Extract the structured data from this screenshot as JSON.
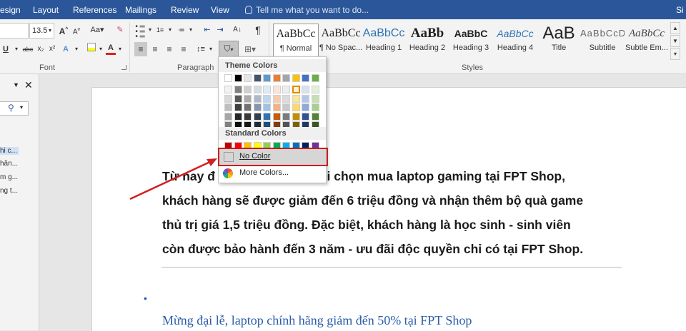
{
  "menubar": {
    "tabs": [
      "esign",
      "Layout",
      "References",
      "Mailings",
      "Review",
      "View"
    ],
    "tell_me": "Tell me what you want to do...",
    "right_cut": "Si"
  },
  "ribbon": {
    "font_size": "13.5",
    "group_labels": {
      "font": "Font",
      "paragraph": "Paragraph",
      "styles": "Styles"
    },
    "styles": [
      {
        "sample": "AaBbCc",
        "name": "¶ Normal"
      },
      {
        "sample": "AaBbCc",
        "name": "¶ No Spac..."
      },
      {
        "sample": "AaBbCc",
        "name": "Heading 1"
      },
      {
        "sample": "AaBb",
        "name": "Heading 2"
      },
      {
        "sample": "AaBbC",
        "name": "Heading 3"
      },
      {
        "sample": "AaBbCc",
        "name": "Heading 4"
      },
      {
        "sample": "AaB",
        "name": "Title"
      },
      {
        "sample": "AaBbCcD",
        "name": "Subtitle"
      },
      {
        "sample": "AaBbCc",
        "name": "Subtle Em..."
      }
    ]
  },
  "nav_pane": {
    "items": [
      "hi c...",
      "hăn...",
      "m g...",
      "ng t..."
    ]
  },
  "palette": {
    "theme_header": "Theme Colors",
    "standard_header": "Standard Colors",
    "no_color": "No Color",
    "more_colors": "More Colors...",
    "theme_top": [
      "#ffffff",
      "#000000",
      "#e7e6e6",
      "#44546a",
      "#5b9bd5",
      "#ed7d31",
      "#a5a5a5",
      "#ffc000",
      "#4472c4",
      "#70ad47"
    ],
    "theme_shades": [
      [
        "#f2f2f2",
        "#d9d9d9",
        "#bfbfbf",
        "#a6a6a6",
        "#808080"
      ],
      [
        "#808080",
        "#595959",
        "#404040",
        "#262626",
        "#0d0d0d"
      ],
      [
        "#d0cece",
        "#aeaaaa",
        "#757171",
        "#3b3838",
        "#171616"
      ],
      [
        "#d6dce4",
        "#adb9ca",
        "#8496b0",
        "#333f4f",
        "#222a35"
      ],
      [
        "#deebf6",
        "#bdd7ee",
        "#9dc3e6",
        "#2e75b5",
        "#1f4e79"
      ],
      [
        "#fbe5d5",
        "#f7cbac",
        "#f4b183",
        "#c55a11",
        "#843c0b"
      ],
      [
        "#ededed",
        "#dbdbdb",
        "#c9c9c9",
        "#7b7b7b",
        "#525252"
      ],
      [
        "#fff2cc",
        "#fee599",
        "#ffd965",
        "#bf9000",
        "#7f6000"
      ],
      [
        "#d9e2f3",
        "#b4c6e7",
        "#8eaadb",
        "#2f5496",
        "#1f3864"
      ],
      [
        "#e2efd9",
        "#c5e0b3",
        "#a8d08d",
        "#538135",
        "#375623"
      ]
    ],
    "standard": [
      "#c00000",
      "#ff0000",
      "#ffc000",
      "#ffff00",
      "#92d050",
      "#00b050",
      "#00b0f0",
      "#0070c0",
      "#002060",
      "#7030a0"
    ]
  },
  "document": {
    "lines": [
      "Từ nay đ                        2, khi chọn mua laptop gaming tại FPT Shop,",
      "khách hàng sẽ được giảm đến 6 triệu đồng và nhận thêm bộ quà game",
      "thủ trị giá 1,5 triệu đồng. Đặc biệt, khách hàng là học sinh - sinh viên",
      "còn được bảo hành đến 3 năm - ưu đãi độc quyền chỉ có tại FPT Shop."
    ],
    "bullet": "•",
    "link_heading": "Mừng đại lễ, laptop chính hãng giảm đến 50% tại FPT Shop"
  },
  "colors": {
    "accent": "#2b579a",
    "highlight_box": "#c8201e",
    "link": "#2a5caa"
  }
}
